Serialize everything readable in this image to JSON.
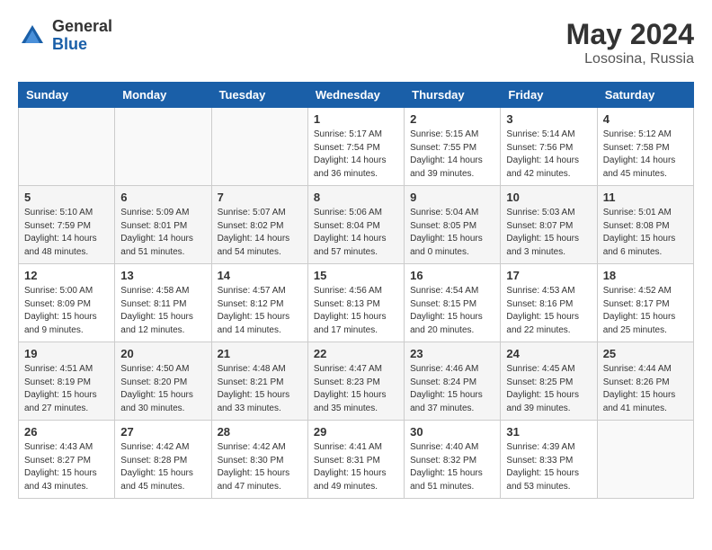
{
  "header": {
    "logo_general": "General",
    "logo_blue": "Blue",
    "title_month": "May 2024",
    "title_location": "Lososina, Russia"
  },
  "weekdays": [
    "Sunday",
    "Monday",
    "Tuesday",
    "Wednesday",
    "Thursday",
    "Friday",
    "Saturday"
  ],
  "weeks": [
    [
      {
        "day": "",
        "info": ""
      },
      {
        "day": "",
        "info": ""
      },
      {
        "day": "",
        "info": ""
      },
      {
        "day": "1",
        "info": "Sunrise: 5:17 AM\nSunset: 7:54 PM\nDaylight: 14 hours\nand 36 minutes."
      },
      {
        "day": "2",
        "info": "Sunrise: 5:15 AM\nSunset: 7:55 PM\nDaylight: 14 hours\nand 39 minutes."
      },
      {
        "day": "3",
        "info": "Sunrise: 5:14 AM\nSunset: 7:56 PM\nDaylight: 14 hours\nand 42 minutes."
      },
      {
        "day": "4",
        "info": "Sunrise: 5:12 AM\nSunset: 7:58 PM\nDaylight: 14 hours\nand 45 minutes."
      }
    ],
    [
      {
        "day": "5",
        "info": "Sunrise: 5:10 AM\nSunset: 7:59 PM\nDaylight: 14 hours\nand 48 minutes."
      },
      {
        "day": "6",
        "info": "Sunrise: 5:09 AM\nSunset: 8:01 PM\nDaylight: 14 hours\nand 51 minutes."
      },
      {
        "day": "7",
        "info": "Sunrise: 5:07 AM\nSunset: 8:02 PM\nDaylight: 14 hours\nand 54 minutes."
      },
      {
        "day": "8",
        "info": "Sunrise: 5:06 AM\nSunset: 8:04 PM\nDaylight: 14 hours\nand 57 minutes."
      },
      {
        "day": "9",
        "info": "Sunrise: 5:04 AM\nSunset: 8:05 PM\nDaylight: 15 hours\nand 0 minutes."
      },
      {
        "day": "10",
        "info": "Sunrise: 5:03 AM\nSunset: 8:07 PM\nDaylight: 15 hours\nand 3 minutes."
      },
      {
        "day": "11",
        "info": "Sunrise: 5:01 AM\nSunset: 8:08 PM\nDaylight: 15 hours\nand 6 minutes."
      }
    ],
    [
      {
        "day": "12",
        "info": "Sunrise: 5:00 AM\nSunset: 8:09 PM\nDaylight: 15 hours\nand 9 minutes."
      },
      {
        "day": "13",
        "info": "Sunrise: 4:58 AM\nSunset: 8:11 PM\nDaylight: 15 hours\nand 12 minutes."
      },
      {
        "day": "14",
        "info": "Sunrise: 4:57 AM\nSunset: 8:12 PM\nDaylight: 15 hours\nand 14 minutes."
      },
      {
        "day": "15",
        "info": "Sunrise: 4:56 AM\nSunset: 8:13 PM\nDaylight: 15 hours\nand 17 minutes."
      },
      {
        "day": "16",
        "info": "Sunrise: 4:54 AM\nSunset: 8:15 PM\nDaylight: 15 hours\nand 20 minutes."
      },
      {
        "day": "17",
        "info": "Sunrise: 4:53 AM\nSunset: 8:16 PM\nDaylight: 15 hours\nand 22 minutes."
      },
      {
        "day": "18",
        "info": "Sunrise: 4:52 AM\nSunset: 8:17 PM\nDaylight: 15 hours\nand 25 minutes."
      }
    ],
    [
      {
        "day": "19",
        "info": "Sunrise: 4:51 AM\nSunset: 8:19 PM\nDaylight: 15 hours\nand 27 minutes."
      },
      {
        "day": "20",
        "info": "Sunrise: 4:50 AM\nSunset: 8:20 PM\nDaylight: 15 hours\nand 30 minutes."
      },
      {
        "day": "21",
        "info": "Sunrise: 4:48 AM\nSunset: 8:21 PM\nDaylight: 15 hours\nand 33 minutes."
      },
      {
        "day": "22",
        "info": "Sunrise: 4:47 AM\nSunset: 8:23 PM\nDaylight: 15 hours\nand 35 minutes."
      },
      {
        "day": "23",
        "info": "Sunrise: 4:46 AM\nSunset: 8:24 PM\nDaylight: 15 hours\nand 37 minutes."
      },
      {
        "day": "24",
        "info": "Sunrise: 4:45 AM\nSunset: 8:25 PM\nDaylight: 15 hours\nand 39 minutes."
      },
      {
        "day": "25",
        "info": "Sunrise: 4:44 AM\nSunset: 8:26 PM\nDaylight: 15 hours\nand 41 minutes."
      }
    ],
    [
      {
        "day": "26",
        "info": "Sunrise: 4:43 AM\nSunset: 8:27 PM\nDaylight: 15 hours\nand 43 minutes."
      },
      {
        "day": "27",
        "info": "Sunrise: 4:42 AM\nSunset: 8:28 PM\nDaylight: 15 hours\nand 45 minutes."
      },
      {
        "day": "28",
        "info": "Sunrise: 4:42 AM\nSunset: 8:30 PM\nDaylight: 15 hours\nand 47 minutes."
      },
      {
        "day": "29",
        "info": "Sunrise: 4:41 AM\nSunset: 8:31 PM\nDaylight: 15 hours\nand 49 minutes."
      },
      {
        "day": "30",
        "info": "Sunrise: 4:40 AM\nSunset: 8:32 PM\nDaylight: 15 hours\nand 51 minutes."
      },
      {
        "day": "31",
        "info": "Sunrise: 4:39 AM\nSunset: 8:33 PM\nDaylight: 15 hours\nand 53 minutes."
      },
      {
        "day": "",
        "info": ""
      }
    ]
  ]
}
